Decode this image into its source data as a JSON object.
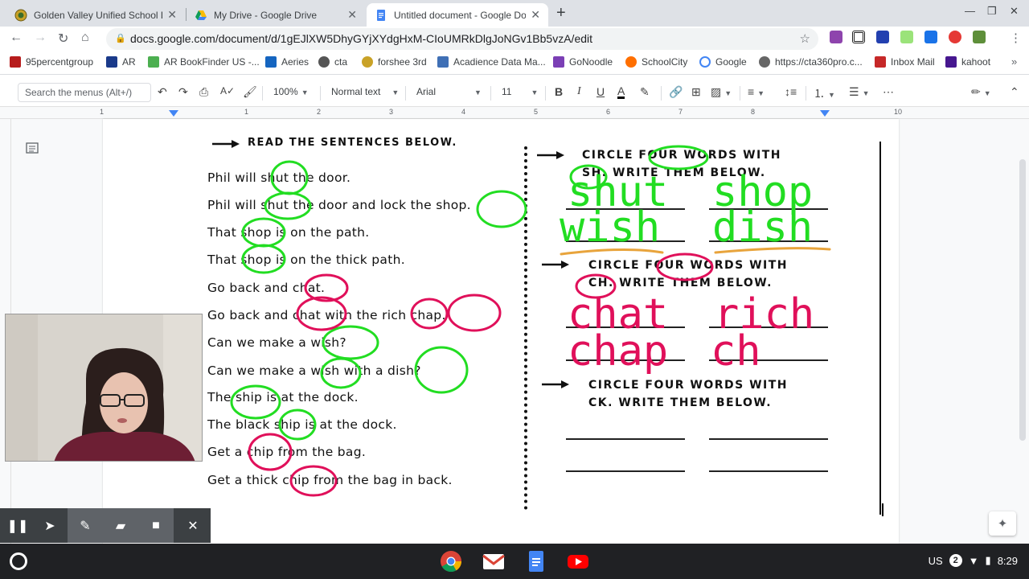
{
  "tabs": [
    {
      "title": "Golden Valley Unified School Dis",
      "close": "✕"
    },
    {
      "title": "My Drive - Google Drive",
      "close": "✕"
    },
    {
      "title": "Untitled document - Google Doc",
      "close": "✕"
    }
  ],
  "address": "docs.google.com/document/d/1gEJlXW5DhyGYjXYdgHxM-CIoUMRkDlgJoNGv1Bb5vzA/edit",
  "bookmarks": [
    "95percentgroup",
    "AR",
    "AR BookFinder US -...",
    "Aeries",
    "cta",
    "forshee 3rd",
    "Acadience Data Ma...",
    "GoNoodle",
    "SchoolCity",
    "Google",
    "https://cta360pro.c...",
    "Inbox Mail",
    "kahoot"
  ],
  "toolbar": {
    "menu_search_placeholder": "Search the menus (Alt+/)",
    "zoom": "100%",
    "style": "Normal text",
    "font": "Arial",
    "size": "11",
    "bold": "B",
    "italic": "I",
    "underline": "U",
    "text_color": "A"
  },
  "ruler_numbers": [
    "1",
    "1",
    "2",
    "3",
    "4",
    "5",
    "6",
    "7",
    "8",
    "9",
    "10"
  ],
  "worksheet": {
    "top_header": "READ THE SENTENCES BELOW.",
    "sentences": [
      "Phil will shut the door.",
      "Phil will shut the door and lock the shop.",
      "That shop is on the path.",
      "That shop is on the thick path.",
      "Go back and chat.",
      "Go back and chat with the rich chap.",
      "Can we make a wish?",
      "Can we make a wish with a dish?",
      "The ship is at the dock.",
      "The black ship is at the dock.",
      "Get a chip from the bag.",
      "Get a thick chip from the bag in back."
    ],
    "sections": [
      {
        "line1": "CIRCLE FOUR WORDS WITH",
        "line2": "SH. WRITE THEM BELOW.",
        "answers": [
          "shut",
          "shop",
          "wish",
          "dish"
        ],
        "color": "#22dd22"
      },
      {
        "line1": "CIRCLE FOUR WORDS WITH",
        "line2": "CH. WRITE THEM BELOW.",
        "answers": [
          "chat",
          "rich",
          "chap",
          "ch"
        ],
        "color": "#e0105a"
      },
      {
        "line1": "CIRCLE FOUR WORDS WITH",
        "line2": "CK. WRITE THEM BELOW.",
        "answers": [],
        "color": "#111111"
      }
    ]
  },
  "shelf": {
    "locale": "US",
    "notifications": "2",
    "time": "8:29"
  },
  "colors": {
    "green_ink": "#22dd22",
    "pink_ink": "#e0105a",
    "orange_ink": "#e8a43c"
  }
}
